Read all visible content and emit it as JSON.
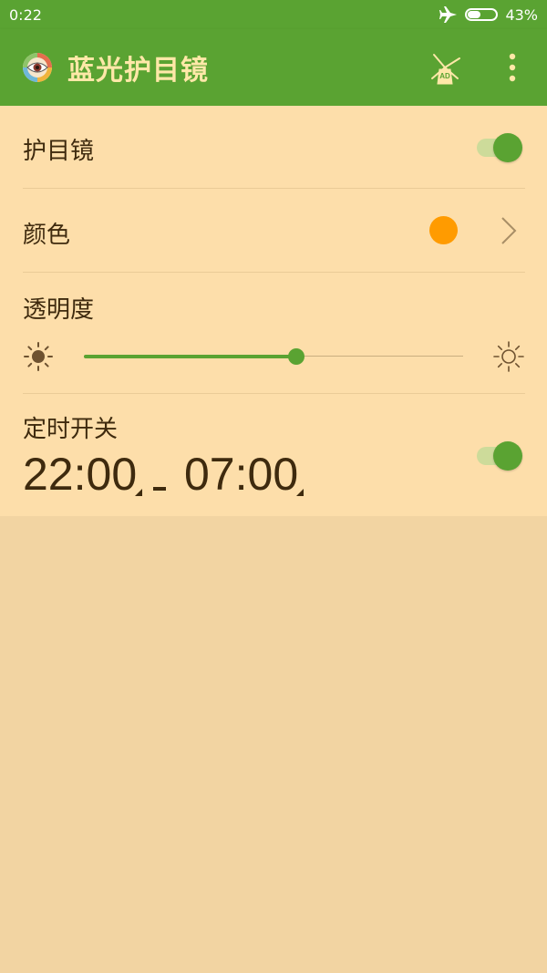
{
  "status_bar": {
    "time": "0:22",
    "battery_text": "43%",
    "battery_level": 0.43,
    "airplane_icon": "airplane-icon"
  },
  "app_bar": {
    "title": "蓝光护目镜",
    "logo_icon": "eye-logo-icon",
    "ad_icon": "windmill-ad-icon",
    "ad_label": "AD",
    "more_icon": "more-vert-icon"
  },
  "settings": {
    "eye_protection": {
      "label": "护目镜",
      "enabled": true
    },
    "color": {
      "label": "颜色",
      "value": "#FF9B00"
    },
    "opacity": {
      "label": "透明度",
      "level": 0.56
    },
    "timer": {
      "label": "定时开关",
      "start": "22:00",
      "end": "07:00",
      "separator": "-",
      "enabled": true
    }
  },
  "colors": {
    "primary": "#5AA332",
    "title_text": "#FFE8A8",
    "panel_bg": "#FDDEAA",
    "page_bg": "#F2D4A2",
    "text": "#3E2A0E",
    "toggle_track": "#CDDB9A"
  }
}
